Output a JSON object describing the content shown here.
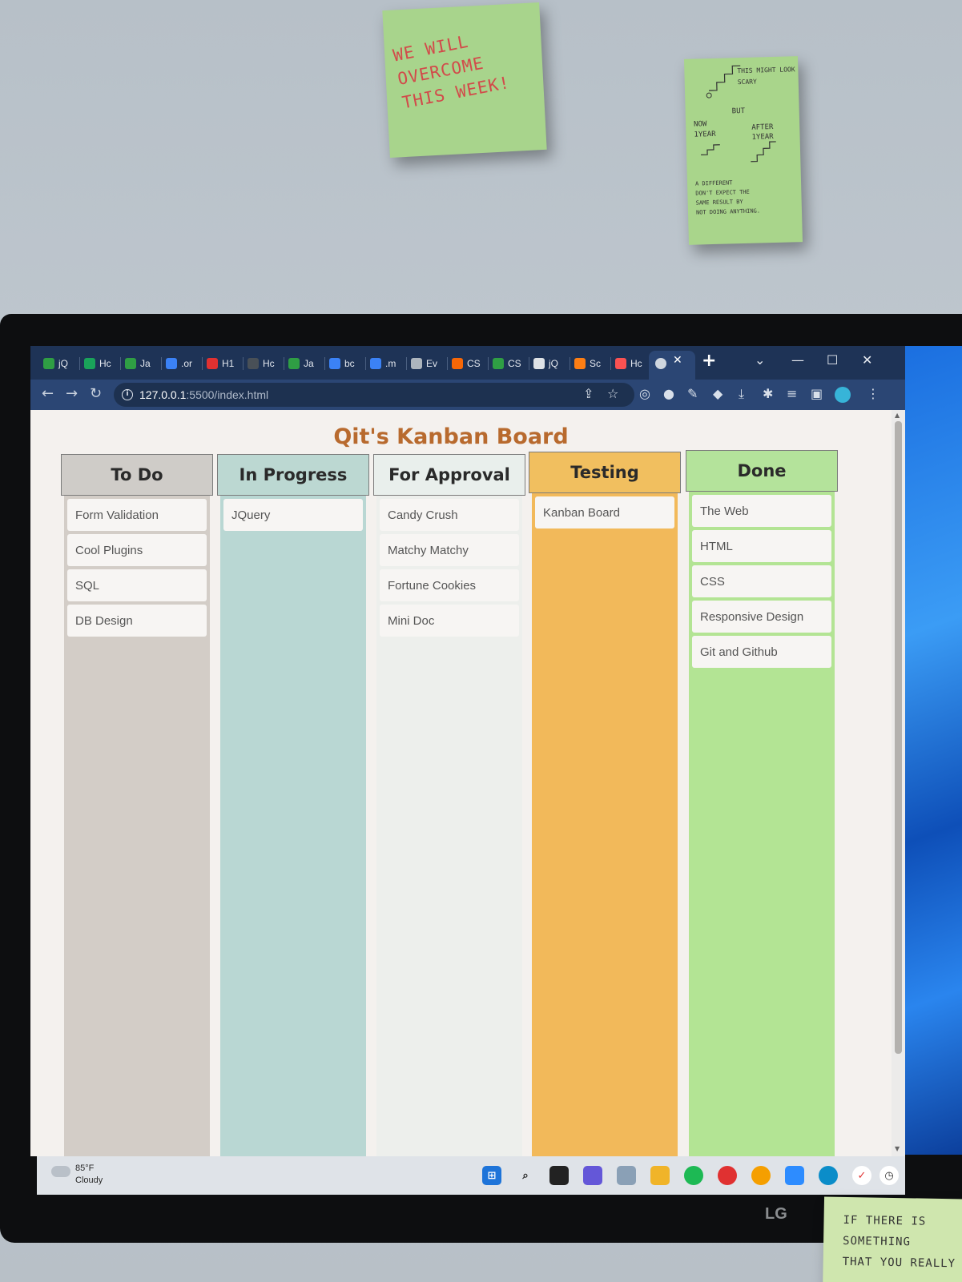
{
  "sticky_notes": {
    "note1": "WE WILL OVERCOME THIS WEEK!",
    "note2_top": "THIS MIGHT LOOK SCARY",
    "note2_mid": "BUT",
    "note2_left": "NOW 1YEAR",
    "note2_right": "AFTER 1YEAR",
    "note2_bottom": "A DIFFERENT\nDON'T EXPECT THE\nSAME RESULT BY\nNOT DOING ANYTHING.",
    "note3": "IF THERE IS\nSOMETHING\nTHAT YOU REALLY"
  },
  "browser": {
    "tabs": [
      {
        "icon": "w-icon",
        "label": "jQ",
        "color": "#2f9e44"
      },
      {
        "icon": "cube-icon",
        "label": "Hc",
        "color": "#1aa35a"
      },
      {
        "icon": "w-icon",
        "label": "Ja",
        "color": "#2f9e44"
      },
      {
        "icon": "wave-icon",
        "label": ".or",
        "color": "#3b82f6"
      },
      {
        "icon": "d-icon",
        "label": "H1",
        "color": "#e03131"
      },
      {
        "icon": "code-icon",
        "label": "Hc",
        "color": "#495057"
      },
      {
        "icon": "w-icon",
        "label": "Ja",
        "color": "#2f9e44"
      },
      {
        "icon": "wave-icon",
        "label": "bc",
        "color": "#3b82f6"
      },
      {
        "icon": "wave-icon",
        "label": ".m",
        "color": "#3b82f6"
      },
      {
        "icon": "m-icon",
        "label": "Ev",
        "color": "#adb5bd"
      },
      {
        "icon": "stack-icon",
        "label": "CS",
        "color": "#f76707"
      },
      {
        "icon": "w-icon",
        "label": "CS",
        "color": "#2f9e44"
      },
      {
        "icon": "jq-icon",
        "label": "jQ",
        "color": "#dee2e6"
      },
      {
        "icon": "shield-icon",
        "label": "Sc",
        "color": "#fd7e14"
      },
      {
        "icon": "swirl-icon",
        "label": "Hc",
        "color": "#fa5252"
      }
    ],
    "url_host": "127.0.0.1",
    "url_rest": ":5500/index.html"
  },
  "page": {
    "title": "Qit's Kanban Board",
    "columns": [
      {
        "name": "To Do",
        "header_color": "#cfccc8",
        "body_color": "#d3cdc7",
        "cards": [
          "Form Validation",
          "Cool Plugins",
          "SQL",
          "DB Design"
        ]
      },
      {
        "name": "In Progress",
        "header_color": "#bcd8d2",
        "body_color": "#b9d7d3",
        "cards": [
          "JQuery"
        ]
      },
      {
        "name": "For Approval",
        "header_color": "#e9efec",
        "body_color": "#edefec",
        "cards": [
          "Candy Crush",
          "Matchy Matchy",
          "Fortune Cookies",
          "Mini Doc"
        ]
      },
      {
        "name": "Testing",
        "header_color": "#f1bf5f",
        "body_color": "#f2b95a",
        "cards": [
          "Kanban Board"
        ]
      },
      {
        "name": "Done",
        "header_color": "#b4e39b",
        "body_color": "#b3e494",
        "cards": [
          "The Web",
          "HTML",
          "CSS",
          "Responsive Design",
          "Git and Github"
        ]
      }
    ]
  },
  "taskbar": {
    "temperature": "85°F",
    "condition": "Cloudy"
  },
  "monitor": {
    "brand": "LG"
  }
}
